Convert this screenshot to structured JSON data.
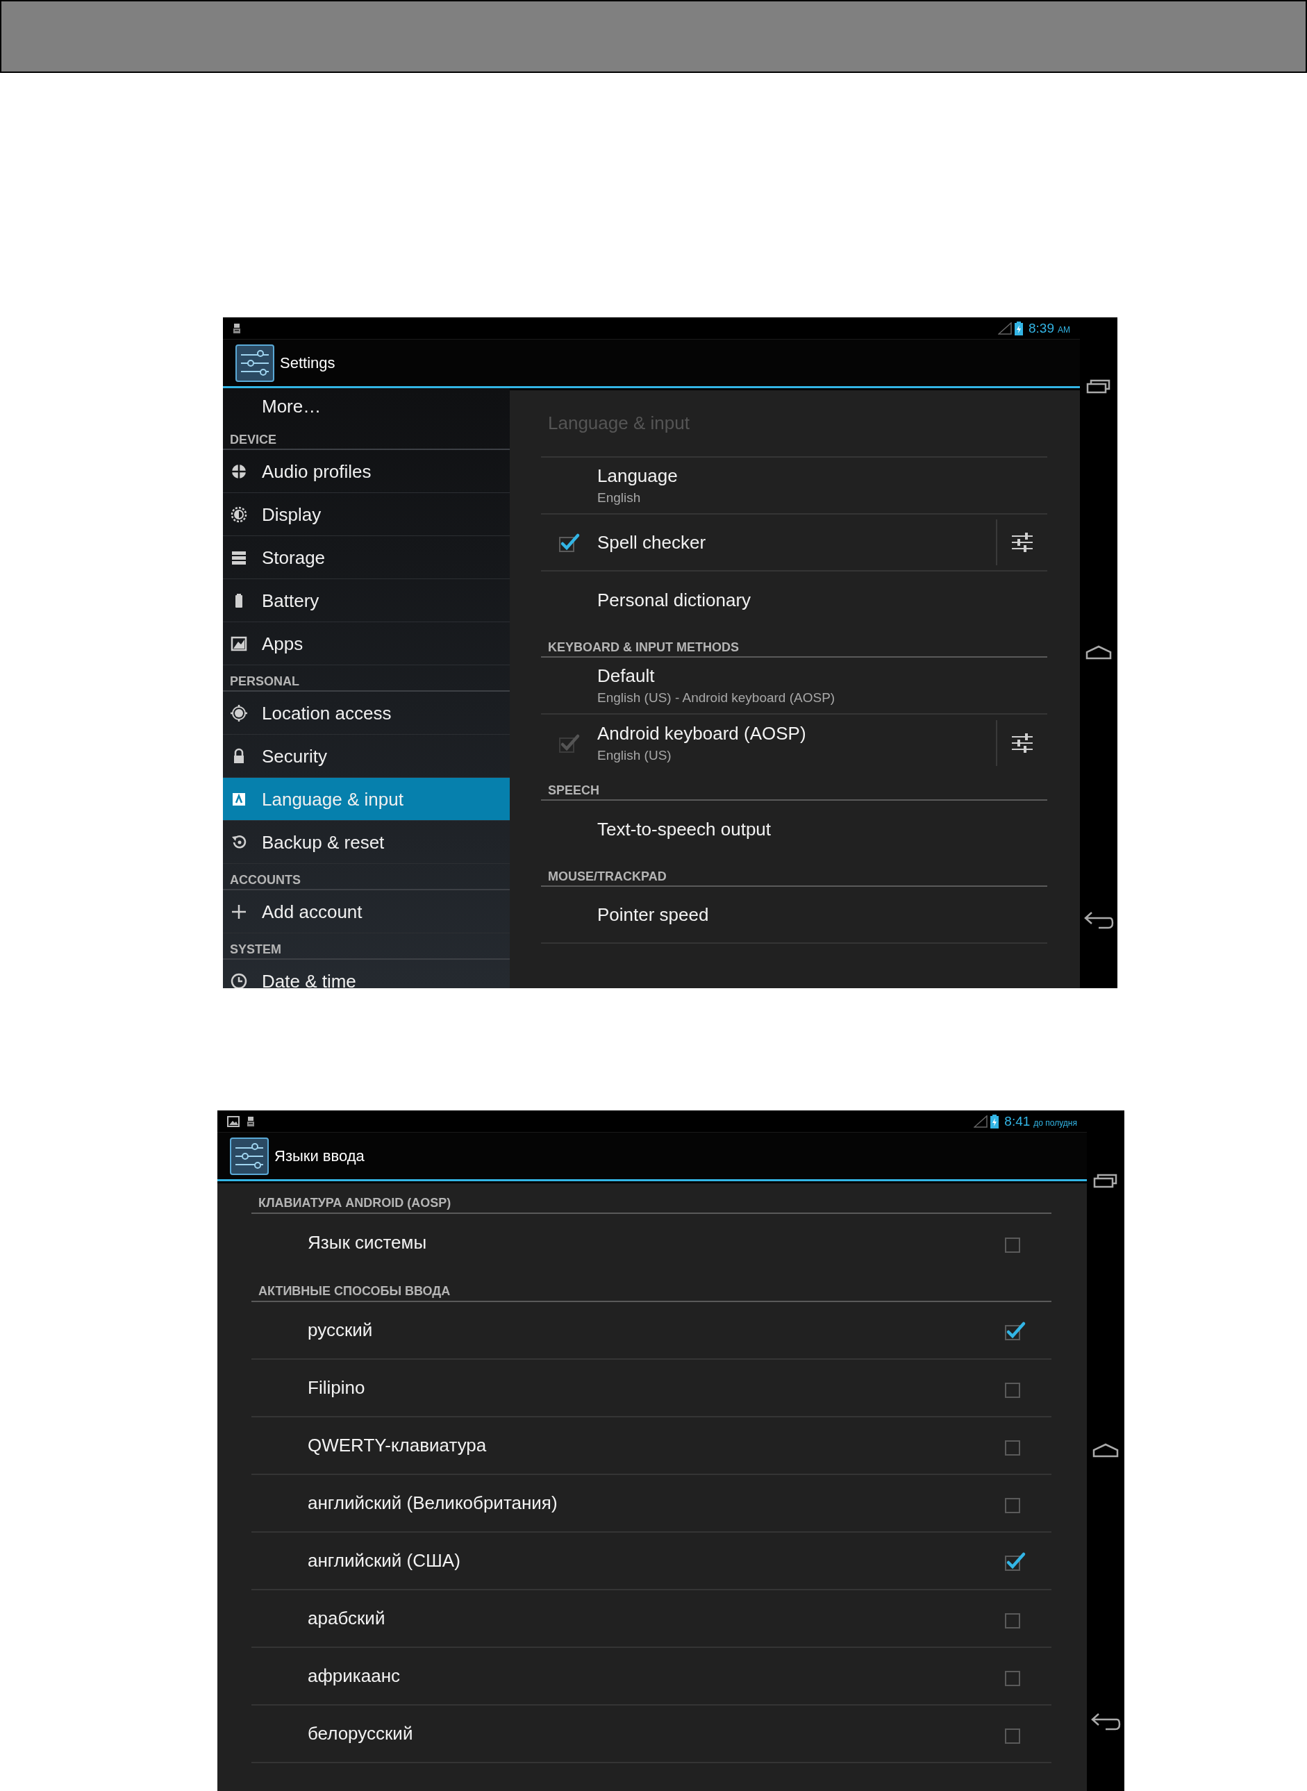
{
  "settings_screen": {
    "status_bar": {
      "time": "8:39",
      "period": "AM"
    },
    "action_bar": {
      "title": "Settings"
    },
    "sidebar": {
      "items": [
        {
          "kind": "item",
          "label": "More…",
          "selected": false
        },
        {
          "kind": "header",
          "label": "DEVICE"
        },
        {
          "kind": "item",
          "label": "Audio profiles",
          "selected": false
        },
        {
          "kind": "item",
          "label": "Display",
          "selected": false
        },
        {
          "kind": "item",
          "label": "Storage",
          "selected": false
        },
        {
          "kind": "item",
          "label": "Battery",
          "selected": false
        },
        {
          "kind": "item",
          "label": "Apps",
          "selected": false
        },
        {
          "kind": "header",
          "label": "PERSONAL"
        },
        {
          "kind": "item",
          "label": "Location access",
          "selected": false
        },
        {
          "kind": "item",
          "label": "Security",
          "selected": false
        },
        {
          "kind": "item",
          "label": "Language & input",
          "selected": true
        },
        {
          "kind": "item",
          "label": "Backup & reset",
          "selected": false
        },
        {
          "kind": "header",
          "label": "ACCOUNTS"
        },
        {
          "kind": "item",
          "label": "Add account",
          "selected": false
        },
        {
          "kind": "header",
          "label": "SYSTEM"
        },
        {
          "kind": "item",
          "label": "Date & time",
          "selected": false
        }
      ]
    },
    "panel": {
      "title": "Language & input",
      "rows": [
        {
          "kind": "item",
          "title": "Language",
          "summary": "English"
        },
        {
          "kind": "checkbox",
          "title": "Spell checker",
          "checked": true,
          "disabled": false,
          "has_settings": true
        },
        {
          "kind": "item",
          "title": "Personal dictionary"
        },
        {
          "kind": "header",
          "title": "KEYBOARD & INPUT METHODS"
        },
        {
          "kind": "item",
          "title": "Default",
          "summary": "English (US) - Android keyboard (AOSP)"
        },
        {
          "kind": "checkbox",
          "title": "Android keyboard (AOSP)",
          "summary": "English (US)",
          "checked": true,
          "disabled": true,
          "has_settings": true
        },
        {
          "kind": "header",
          "title": "SPEECH"
        },
        {
          "kind": "item",
          "title": "Text-to-speech output"
        },
        {
          "kind": "header",
          "title": "MOUSE/TRACKPAD"
        },
        {
          "kind": "item",
          "title": "Pointer speed"
        }
      ]
    }
  },
  "input_languages_screen": {
    "status_bar": {
      "time": "8:41",
      "period": "до полудня"
    },
    "action_bar": {
      "title": "Языки ввода"
    },
    "sections": [
      {
        "header": "КЛАВИАТУРА ANDROID (AOSP)",
        "rows": [
          {
            "label": "Язык системы",
            "checked": false
          }
        ]
      },
      {
        "header": "АКТИВНЫЕ СПОСОБЫ ВВОДА",
        "rows": [
          {
            "label": "русский",
            "checked": true
          },
          {
            "label": "Filipino",
            "checked": false
          },
          {
            "label": "QWERTY-клавиатура",
            "checked": false
          },
          {
            "label": "английский (Великобритания)",
            "checked": false
          },
          {
            "label": "английский (США)",
            "checked": true
          },
          {
            "label": "арабский",
            "checked": false
          },
          {
            "label": "африкаанс",
            "checked": false
          },
          {
            "label": "белорусский",
            "checked": false
          }
        ]
      }
    ]
  }
}
